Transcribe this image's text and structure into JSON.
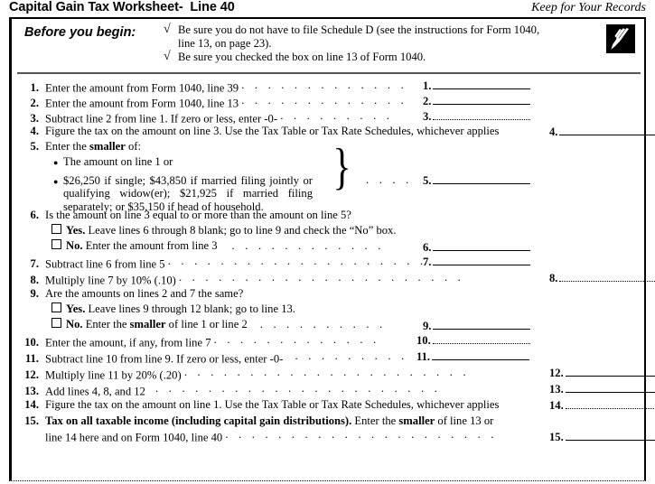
{
  "header": {
    "title": "Capital Gain Tax Worksheet-  Line 40",
    "keep_note": "Keep for Your Records"
  },
  "before_you_begin": {
    "label": "Before you begin:",
    "check_mark": "√",
    "items": [
      "Be sure you do not have to file Schedule D (see the instructions for Form 1040, line 13, on page 23).",
      "Be sure you checked the box on line 13 of Form 1040."
    ],
    "icon": "pen-writing-icon"
  },
  "lines": {
    "l1": {
      "num": "1.",
      "text": "Enter the amount from Form 1040, line 39",
      "answer": "1."
    },
    "l2": {
      "num": "2.",
      "text": "Enter the amount from Form 1040, line 13",
      "answer": "2."
    },
    "l3": {
      "num": "3.",
      "text": "Subtract line 2 from line 1. If zero or less, enter -0-",
      "answer": "3."
    },
    "l4": {
      "num": "4.",
      "text": "Figure the tax on the amount on line 3. Use the Tax Table or Tax Rate Schedules, whichever applies",
      "answer": "4."
    },
    "l5": {
      "num": "5.",
      "lead_a": "Enter the ",
      "lead_b": "smaller",
      "lead_c": " of:",
      "bullet1": "The amount on line 1 or",
      "bullet2": "$26,250 if single; $43,850 if married filing jointly or qualifying widow(er); $21,925 if married filing separately; or $35,150 if head of household.",
      "answer": "5."
    },
    "l6": {
      "num": "6.",
      "question": "Is the amount on line 3 equal to or more than the amount on line 5?",
      "yes_label": "Yes.",
      "yes_text": " Leave lines 6 through 8 blank; go to line 9 and check the “No” box.",
      "no_label": "No.",
      "no_text": " Enter the amount from line 3",
      "answer": "6."
    },
    "l7": {
      "num": "7.",
      "text": "Subtract line 6 from line 5",
      "answer": "7."
    },
    "l8": {
      "num": "8.",
      "text": "Multiply line 7 by 10% (.10)",
      "answer": "8."
    },
    "l9": {
      "num": "9.",
      "question": "Are the amounts on lines 2 and 7 the same?",
      "yes_label": "Yes.",
      "yes_text": " Leave lines 9 through 12 blank; go to line 13.",
      "no_label": "No.",
      "no_text_a": " Enter the ",
      "no_text_b": "smaller",
      "no_text_c": " of line 1 or line 2",
      "answer": "9."
    },
    "l10": {
      "num": "10.",
      "text": "Enter the amount, if any, from line 7",
      "answer": "10."
    },
    "l11": {
      "num": "11.",
      "text": "Subtract line 10 from line 9. If zero or less, enter -0-",
      "answer": "11."
    },
    "l12": {
      "num": "12.",
      "text": "Multiply line 11 by 20% (.20)",
      "answer": "12."
    },
    "l13": {
      "num": "13.",
      "text": "Add lines 4, 8, and 12",
      "answer": "13."
    },
    "l14": {
      "num": "14.",
      "text": "Figure the tax on the amount on line 1. Use the Tax Table or Tax Rate Schedules, whichever applies",
      "answer": "14."
    },
    "l15": {
      "num": "15.",
      "bold_part": "Tax on all taxable income (including capital gain distributions).",
      "text_a": " Enter the ",
      "text_b": "smaller",
      "text_c": " of line 13 or",
      "text_line2": "line 14 here and on Form 1040, line 40",
      "answer": "15."
    }
  },
  "leaders": {
    "d13": ". . . . . . . . . . . . .",
    "d12": ". . . . . . . . . . . .",
    "d11": ". . . . . . . . . . .",
    "d10": ". . . . . . . . . .",
    "d9": ". . . . . . . . .",
    "d6": ". . . . . .",
    "d5": ". . . . .",
    "d4": ". . . .",
    "d20": ". . . . . . . . . . . . . . . . . . . .",
    "d19": ". . . . . . . . . . . . . . . . . . .",
    "d22": ". . . . . . . . . . . . . . . . . . . . . .",
    "d21": ". . . . . . . . . . . . . . . . . . . . ."
  }
}
